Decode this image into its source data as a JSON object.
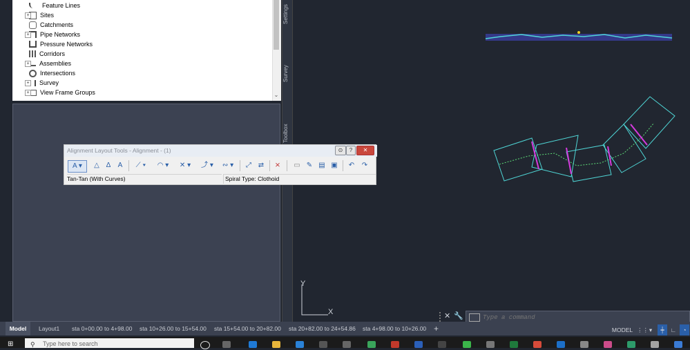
{
  "prospector": {
    "items": [
      {
        "label": "Feature Lines",
        "expandable": false
      },
      {
        "label": "Sites",
        "expandable": true
      },
      {
        "label": "Catchments",
        "expandable": false
      },
      {
        "label": "Pipe Networks",
        "expandable": true
      },
      {
        "label": "Pressure Networks",
        "expandable": false
      },
      {
        "label": "Corridors",
        "expandable": false
      },
      {
        "label": "Assemblies",
        "expandable": true
      },
      {
        "label": "Intersections",
        "expandable": false
      },
      {
        "label": "Survey",
        "expandable": true
      },
      {
        "label": "View Frame Groups",
        "expandable": true
      }
    ]
  },
  "side_tabs": {
    "settings": "Settings",
    "survey": "Survey",
    "toolbox": "Toolbox"
  },
  "toolbar": {
    "title": "Alignment Layout Tools - Alignment - (1)",
    "tangent_mode": "Tan-Tan (With Curves)",
    "spiral_type": "Spiral Type: Clothoid"
  },
  "layout_tabs": [
    "Model",
    "Layout1",
    "sta 0+00.00 to 4+98.00",
    "sta 10+26.00 to 15+54.00",
    "sta 15+54.00 to 20+82.00",
    "sta 20+82.00 to 24+54.86",
    "sta 4+98.00 to 10+26.00",
    "+"
  ],
  "command": {
    "placeholder": "Type a command"
  },
  "statusbar": {
    "model": "MODEL"
  },
  "ucs": {
    "x": "X",
    "y": "Y"
  },
  "taskbar": {
    "search_placeholder": "Type here to search"
  },
  "colors": {
    "accent": "#2a5fa8",
    "cyan": "#4fd6d6",
    "magenta": "#d63adf"
  }
}
